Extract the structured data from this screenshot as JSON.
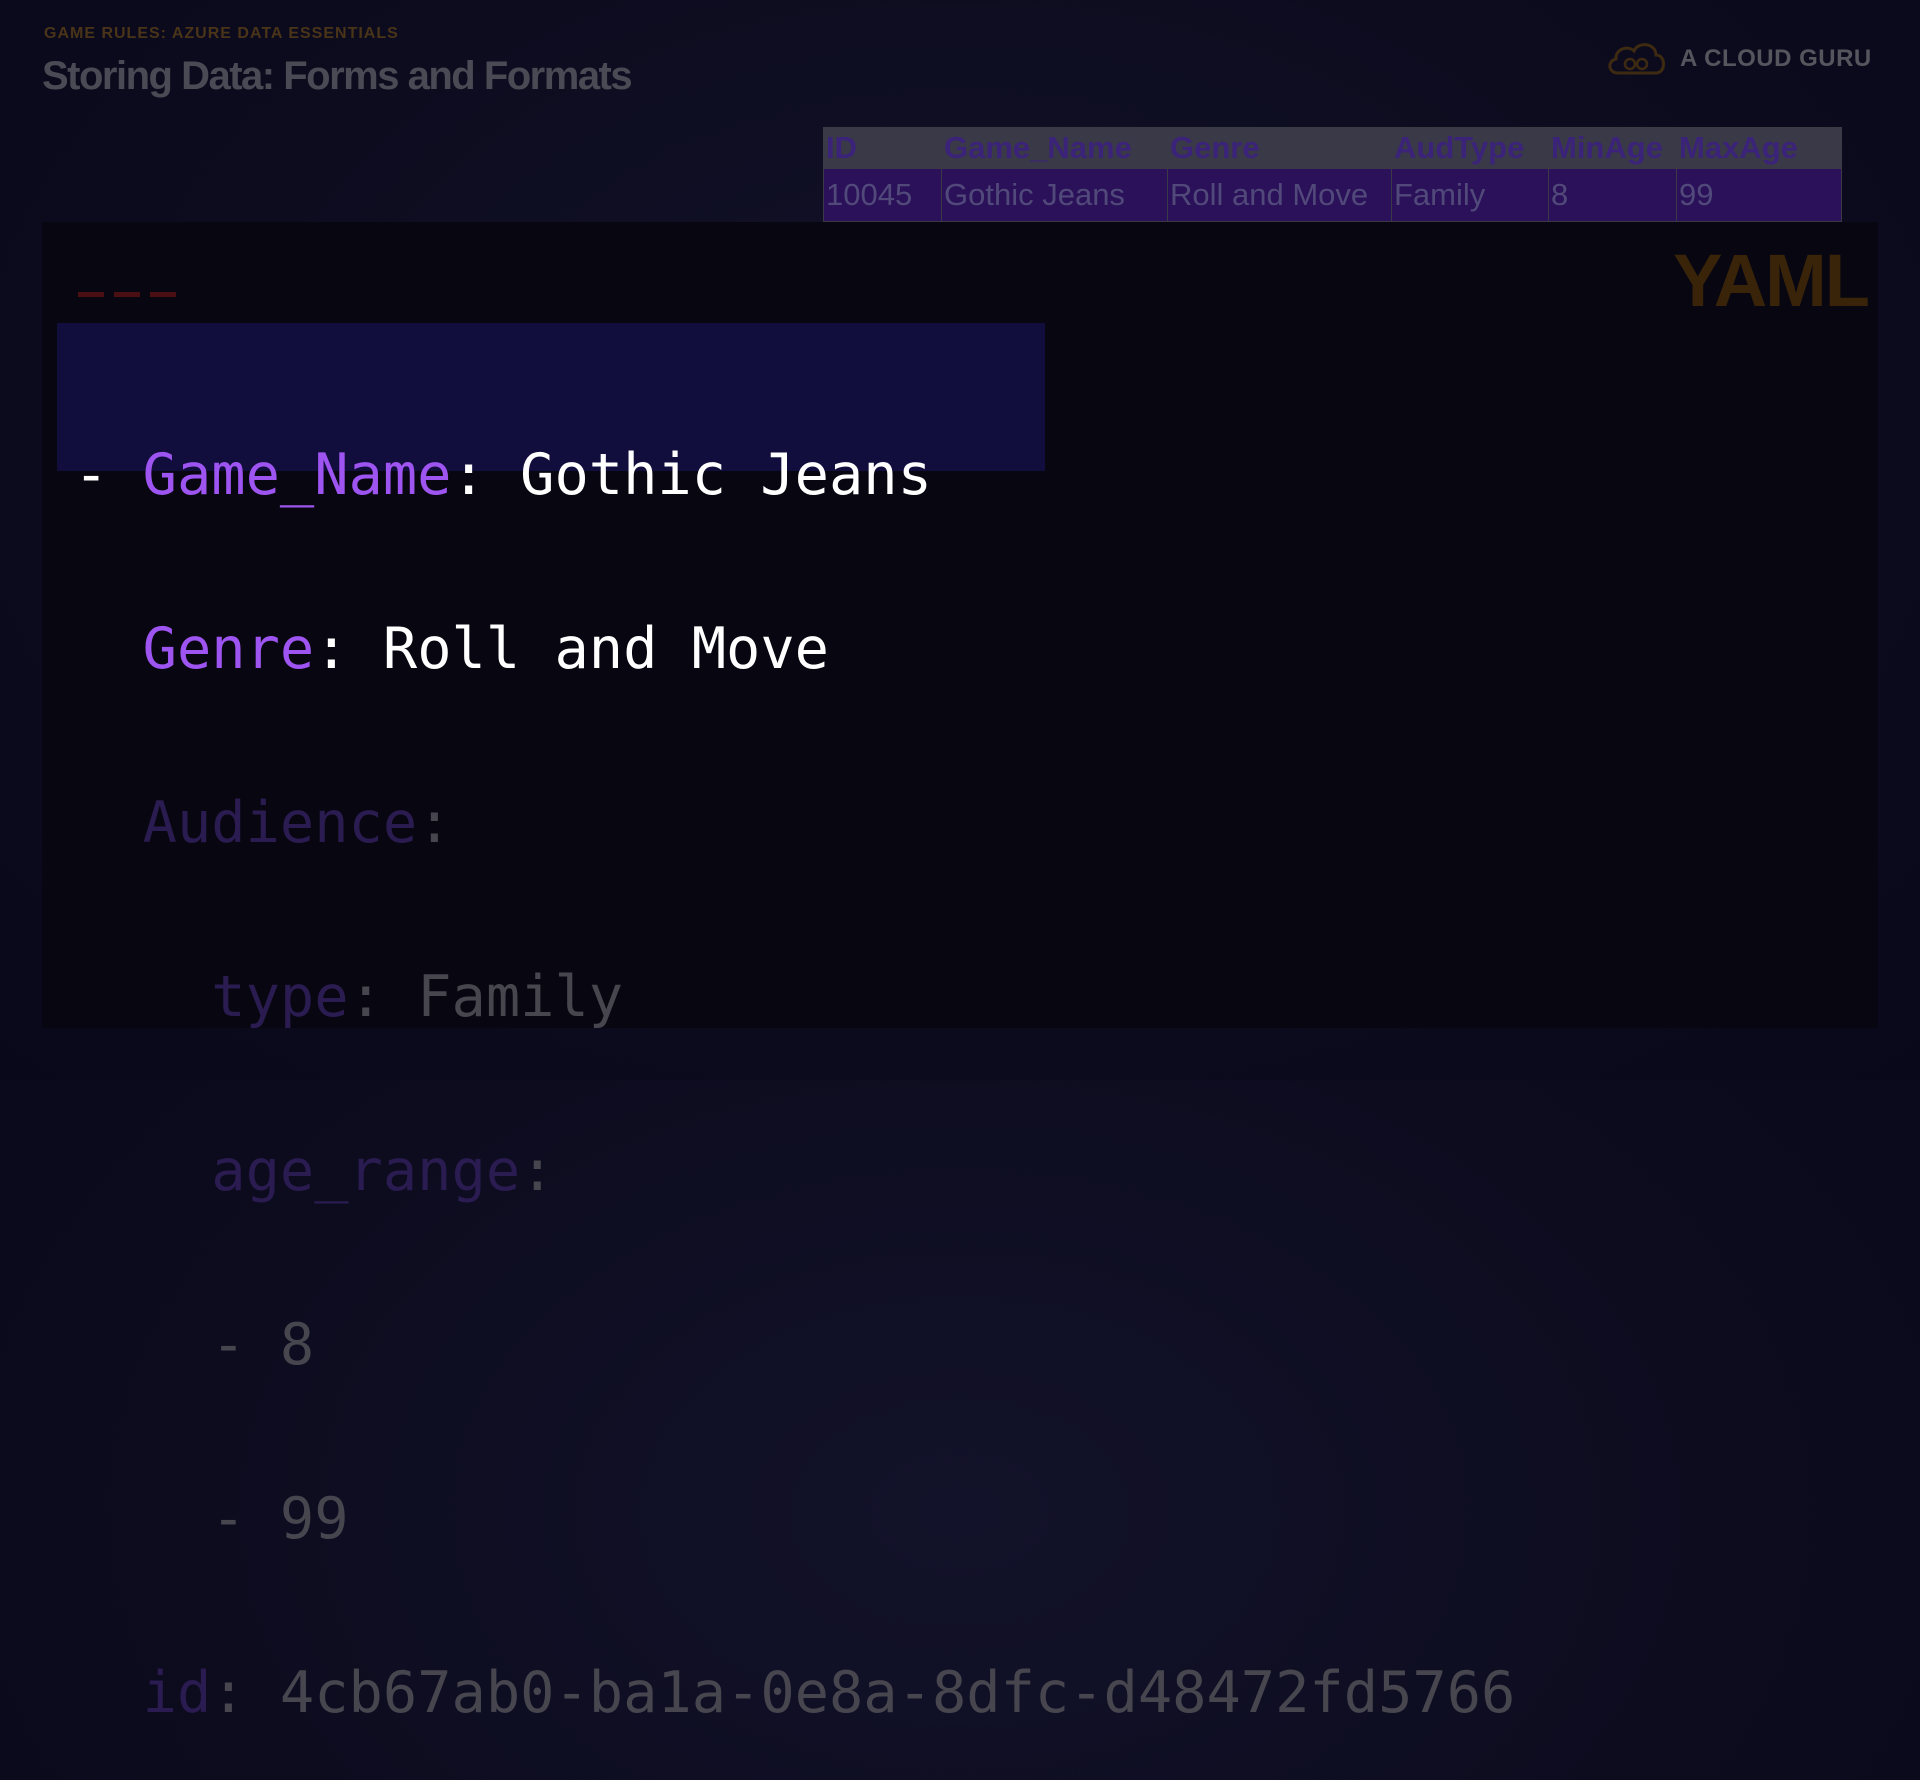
{
  "header": {
    "eyebrow": "GAME RULES: AZURE DATA ESSENTIALS",
    "title": "Storing Data: Forms and Formats"
  },
  "brand": {
    "name": "A CLOUD GURU",
    "logo_icon": "cloud-icon"
  },
  "table": {
    "columns": [
      "ID",
      "Game_Name",
      "Genre",
      "AudType",
      "MinAge",
      "MaxAge"
    ],
    "rows": [
      [
        "10045",
        "Gothic Jeans",
        "Roll and Move",
        "Family",
        "8",
        "99"
      ]
    ]
  },
  "format_label": "YAML",
  "yaml": {
    "doc_start": "---",
    "game_name_key": "Game_Name",
    "game_name_value": "Gothic Jeans",
    "genre_key": "Genre",
    "genre_value": "Roll and Move",
    "audience_key": "Audience",
    "type_key": "type",
    "type_value": "Family",
    "age_range_key": "age_range",
    "age_values": [
      "8",
      "99"
    ],
    "id_key": "id",
    "id_value": "4cb67ab0-ba1a-0e8a-8dfc-d48472fd5766"
  },
  "colors": {
    "background": "#0d0c1f",
    "key_highlight": "#9d54f0",
    "value_highlight": "#ffffff",
    "highlight_band": "#110d3d",
    "yaml_label": "#3a2409"
  }
}
